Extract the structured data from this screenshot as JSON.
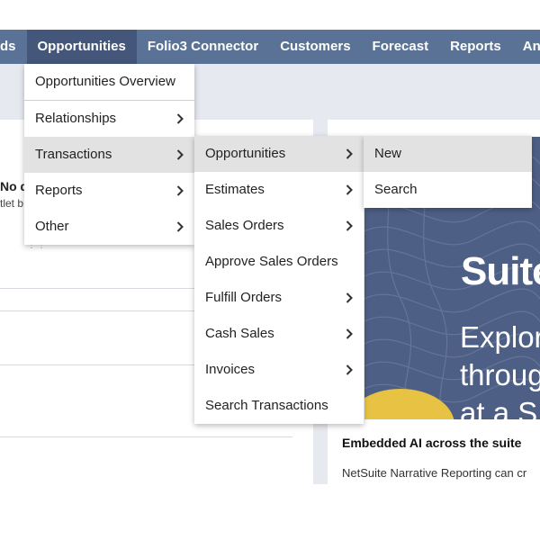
{
  "nav": {
    "items": [
      "ds",
      "Opportunities",
      "Folio3 Connector",
      "Customers",
      "Forecast",
      "Reports",
      "Analy"
    ]
  },
  "left_card": {
    "nodata": "No d",
    "portlet": "tlet b",
    "grip": "⋮⋮"
  },
  "menu1": {
    "overview": "Opportunities Overview",
    "items": [
      "Relationships",
      "Transactions",
      "Reports",
      "Other"
    ]
  },
  "menu2": {
    "items": [
      "Opportunities",
      "Estimates",
      "Sales Orders",
      "Approve Sales Orders",
      "Fulfill Orders",
      "Cash Sales",
      "Invoices",
      "Search Transactions"
    ]
  },
  "menu3": {
    "items": [
      "New",
      "Search"
    ]
  },
  "banner": {
    "title": "Suite",
    "text": "Explor\nthroug\nat a S"
  },
  "article": {
    "title": "Embedded AI across the suite",
    "text": "NetSuite Narrative Reporting can cr"
  },
  "colors": {
    "nav_bg": "#5b7297",
    "nav_active": "#44577a",
    "banner_bg": "#4e5f86",
    "accent_yellow": "#e8c343"
  }
}
